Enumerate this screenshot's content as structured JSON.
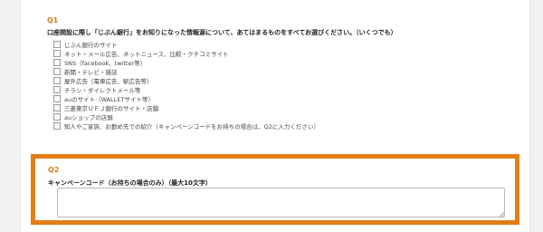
{
  "q1": {
    "label": "Q1",
    "question": "口座開設に際し「じぶん銀行」をお知りになった情報源について、あてはまるものをすべてお選びください。（いくつでも）",
    "options": [
      "じぶん銀行のサイト",
      "ネット・メール広告、ネットニュース、比較・クチコミサイト",
      "SNS（facebook、twitter等）",
      "新聞・テレビ・雑誌",
      "屋外広告（電車広告、駅広告等）",
      "チラシ・ダイレクトメール等",
      "auのサイト（WALLETサイト等）",
      "三菱東京ＵＦＪ銀行のサイト・店舗",
      "auショップの店頭",
      "知人やご家族、お勤め先での紹介（キャンペーンコードをお持ちの場合は、Q2に入力ください）"
    ]
  },
  "q2": {
    "label": "Q2",
    "question": "キャンペーンコード（お持ちの場合のみ）（最大10文字）",
    "input_value": "",
    "input_placeholder": ""
  },
  "colors": {
    "accent": "#e37d16",
    "label": "#e07b14"
  }
}
